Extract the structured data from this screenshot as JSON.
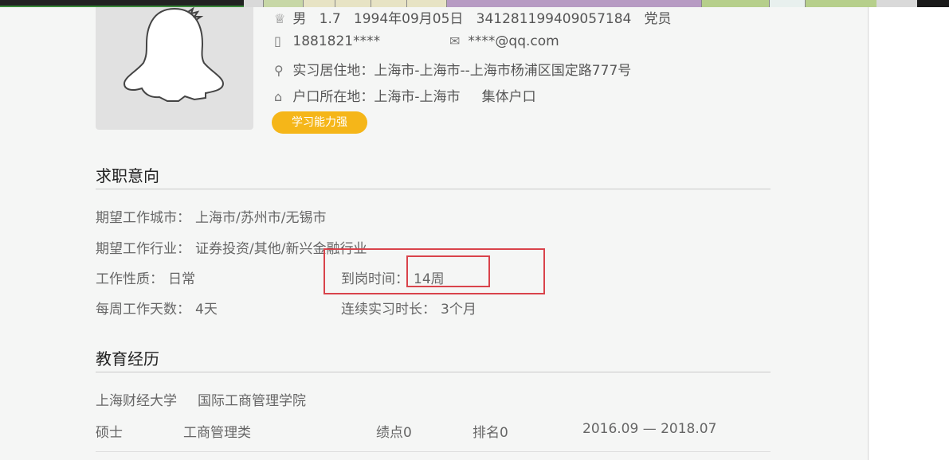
{
  "profile": {
    "gender": "男",
    "height": "1.7",
    "birthday": "1994年09月05日",
    "id_number": "341281199409057184",
    "politics": "党员",
    "phone": "1881821****",
    "email": "****@qq.com",
    "internship_residence": "实习居住地：上海市-上海市--上海市杨浦区国定路777号",
    "hukou": "户口所在地：上海市-上海市",
    "hukou_type": "集体户口",
    "tag": "学习能力强"
  },
  "job_intent": {
    "title": "求职意向",
    "city_label": "期望工作城市：",
    "city_value": "上海市/苏州市/无锡市",
    "industry_label": "期望工作行业：",
    "industry_value": "证券投资/其他/新兴金融行业",
    "nature_label": "工作性质：",
    "nature_value": "日常",
    "arrival_label": "到岗时间：",
    "arrival_value": "14周",
    "days_label": "每周工作天数：",
    "days_value": "4天",
    "duration_label": "连续实习时长：",
    "duration_value": "3个月"
  },
  "education": {
    "title": "教育经历",
    "school": "上海财经大学",
    "college": "国际工商管理学院",
    "degree": "硕士",
    "major": "工商管理类",
    "gpa": "绩点0",
    "rank": "排名0",
    "period": "2016.09 — 2018.07"
  },
  "icons": {
    "gender": "person-icon",
    "phone": "phone-icon",
    "email": "mail-icon",
    "location": "location-pin-icon",
    "home": "home-icon"
  },
  "colors": {
    "tag_bg": "#f5b619",
    "highlight": "#d9434b"
  }
}
